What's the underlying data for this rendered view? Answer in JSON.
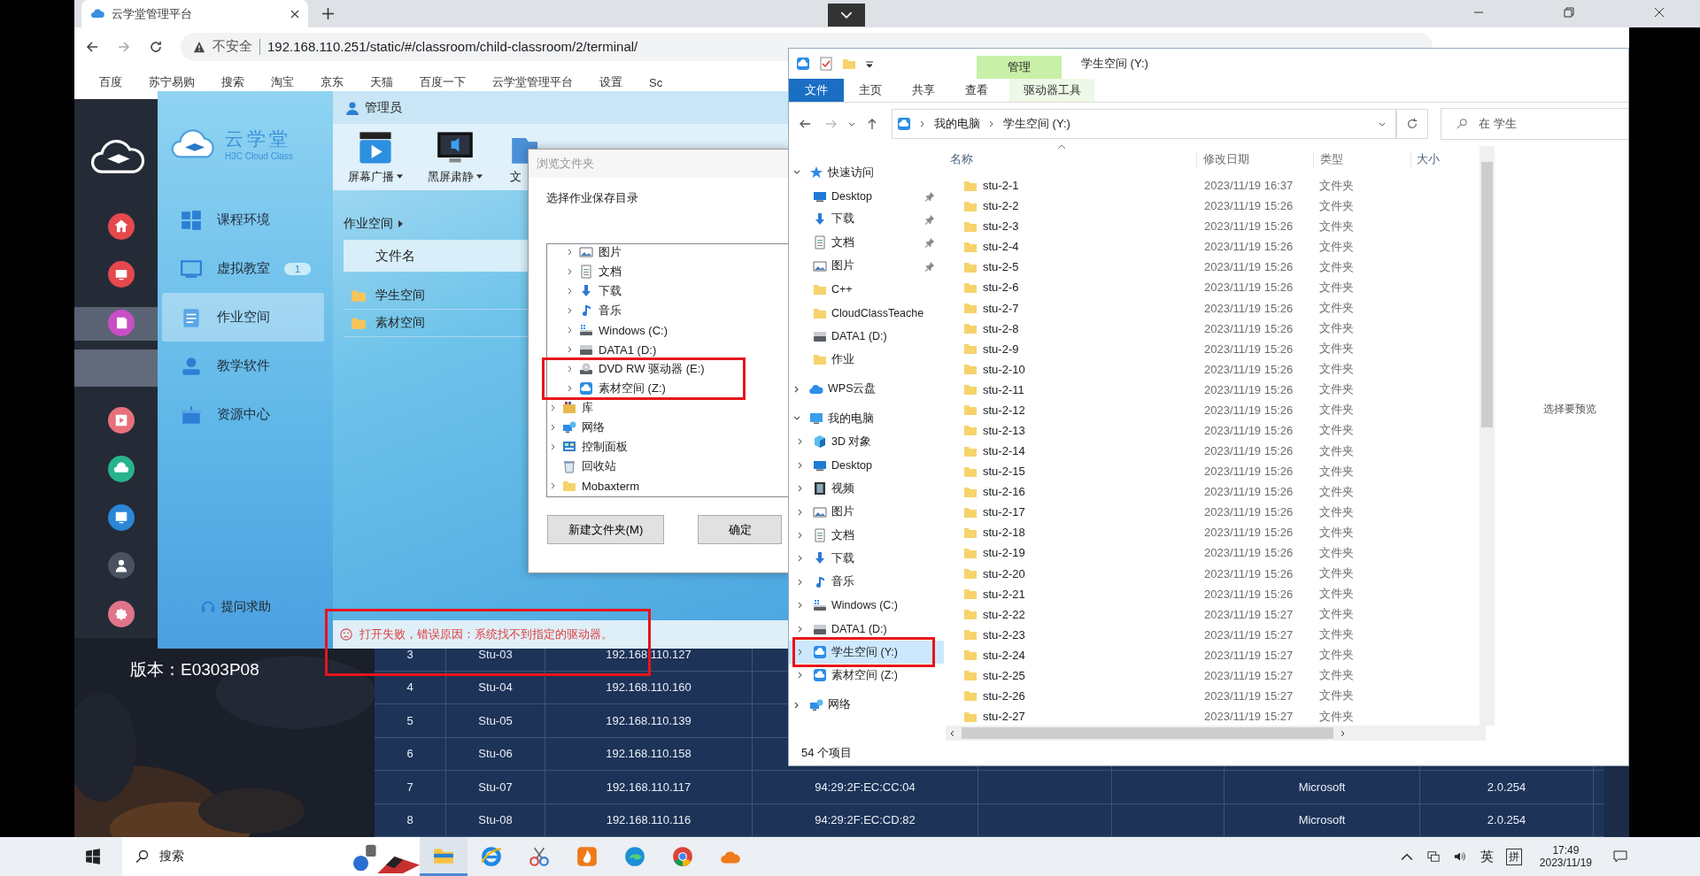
{
  "browser": {
    "tab": {
      "title": "云学堂管理平台"
    },
    "security": "不安全",
    "url": "192.168.110.251/static/#/classroom/child-classroom/2/terminal/",
    "bookmarks": [
      {
        "label": "百度"
      },
      {
        "label": "苏宁易购"
      },
      {
        "label": "搜索"
      },
      {
        "label": "淘宝"
      },
      {
        "label": "京东"
      },
      {
        "label": "天猫"
      },
      {
        "label": "百度一下"
      },
      {
        "label": "云学堂管理平台"
      },
      {
        "label": "设置"
      },
      {
        "label": "Sc"
      }
    ]
  },
  "webpage": {
    "version": "版本：E0303P08",
    "nav": [
      {
        "kind": "home",
        "color": "#e5484d",
        "selected": false
      },
      {
        "kind": "monitor",
        "color": "#e5484d",
        "selected": false
      },
      {
        "kind": "book",
        "color": "#c84fc4",
        "selected": true
      },
      {
        "kind": "sub",
        "selected": true
      },
      {
        "kind": "play",
        "color": "#e8707a",
        "selected": false
      },
      {
        "kind": "cloud",
        "color": "#27b38c",
        "selected": false
      },
      {
        "kind": "screen",
        "color": "#2b86d6",
        "selected": false
      },
      {
        "kind": "person",
        "color": "#4a5260",
        "selected": false
      },
      {
        "kind": "gear",
        "color": "#e0758a",
        "selected": false
      }
    ],
    "table": {
      "rows": [
        {
          "cells": [
            "3",
            "Stu-03",
            "192.168.110.127"
          ]
        },
        {
          "cells": [
            "4",
            "Stu-04",
            "192.168.110.160"
          ]
        },
        {
          "cells": [
            "5",
            "Stu-05",
            "192.168.110.139"
          ]
        },
        {
          "cells": [
            "6",
            "Stu-06",
            "192.168.110.158"
          ]
        },
        {
          "cells": [
            "7",
            "Stu-07",
            "192.168.110.117",
            "94:29:2F:EC:CC:04",
            "",
            "",
            "Microsoft",
            "2.0.254"
          ]
        },
        {
          "cells": [
            "8",
            "Stu-08",
            "192.168.110.116",
            "94:29:2F:EC:CD:82",
            "",
            "",
            "Microsoft",
            "2.0.254"
          ]
        }
      ]
    }
  },
  "app": {
    "logo": {
      "name": "云学堂",
      "sub": "H3C Cloud Class"
    },
    "user": "管理员",
    "tools": [
      {
        "label": "屏幕广播",
        "kind": "broadcast",
        "dropdown": true
      },
      {
        "label": "黑屏肃静",
        "kind": "blackscreen",
        "dropdown": true
      },
      {
        "label": "文",
        "kind": "files",
        "dropdown": false
      }
    ],
    "nav": [
      {
        "label": "课程环境",
        "kind": "windows",
        "selected": false
      },
      {
        "label": "虚拟教室",
        "kind": "board",
        "badge": "1",
        "selected": false
      },
      {
        "label": "作业空间",
        "kind": "notepad",
        "selected": true
      },
      {
        "label": "教学软件",
        "kind": "disk",
        "selected": false
      },
      {
        "label": "资源中心",
        "kind": "gift",
        "selected": false
      }
    ],
    "help": "提问求助",
    "breadcrumb": "作业空间",
    "list_header": "文件名",
    "files": [
      "学生空间",
      "素材空间"
    ],
    "error": "打开失败，错误原因：系统找不到指定的驱动器。"
  },
  "dialog": {
    "title": "浏览文件夹",
    "prompt": "选择作业保存目录",
    "tree": [
      {
        "children": [
          {
            "label": "图片",
            "kind": "pictures",
            "expandable": true
          },
          {
            "label": "文档",
            "kind": "doc",
            "expandable": true
          },
          {
            "label": "下载",
            "kind": "download",
            "expandable": true
          },
          {
            "label": "音乐",
            "kind": "music",
            "expandable": true
          },
          {
            "label": "Windows (C:)",
            "kind": "windrive",
            "expandable": true
          },
          {
            "label": "DATA1 (D:)",
            "kind": "drive",
            "expandable": true
          },
          {
            "label": "DVD RW 驱动器 (E:)",
            "kind": "dvd",
            "expandable": true
          },
          {
            "label": "素材空间 (Z:)",
            "kind": "netdrive",
            "expandable": true
          }
        ]
      },
      {
        "label": "库",
        "kind": "library",
        "expandable": true
      },
      {
        "label": "网络",
        "kind": "network",
        "expandable": true
      },
      {
        "label": "控制面板",
        "kind": "control",
        "expandable": true
      },
      {
        "label": "回收站",
        "kind": "recycle",
        "expandable": false
      },
      {
        "label": "Mobaxterm",
        "kind": "folder",
        "expandable": true
      }
    ],
    "buttons": [
      "新建文件夹(M)",
      "确定"
    ]
  },
  "explorer": {
    "title": "学生空间 (Y:)",
    "context_group": "管理",
    "ribbon": [
      {
        "label": "文件",
        "kind": "file"
      },
      {
        "label": "主页",
        "kind": "tab"
      },
      {
        "label": "共享",
        "kind": "tab"
      },
      {
        "label": "查看",
        "kind": "tab"
      },
      {
        "label": "驱动器工具",
        "kind": "context"
      }
    ],
    "path": [
      "我的电脑",
      "学生空间 (Y:)"
    ],
    "search_placeholder": "在 学生",
    "nav": [
      {
        "label": "快速访问",
        "kind": "star",
        "expanded": true,
        "children": [
          {
            "label": "Desktop",
            "kind": "desktop",
            "pinned": true
          },
          {
            "label": "下载",
            "kind": "download",
            "pinned": true
          },
          {
            "label": "文档",
            "kind": "doc",
            "pinned": true
          },
          {
            "label": "图片",
            "kind": "pictures",
            "pinned": true
          },
          {
            "label": "C++",
            "kind": "folder",
            "pinned": false
          },
          {
            "label": "CloudClassTeache",
            "kind": "folder",
            "pinned": false
          },
          {
            "label": "DATA1 (D:)",
            "kind": "drive",
            "pinned": false
          },
          {
            "label": "作业",
            "kind": "folder",
            "pinned": false
          }
        ]
      },
      {
        "label": "WPS云盘",
        "kind": "cloud",
        "expanded": false
      },
      {
        "label": "我的电脑",
        "kind": "pc",
        "expanded": true,
        "children": [
          {
            "label": "3D 对象",
            "kind": "cube",
            "expanded": false,
            "selected": false
          },
          {
            "label": "Desktop",
            "kind": "desktop",
            "expanded": false,
            "selected": false
          },
          {
            "label": "视频",
            "kind": "video",
            "expanded": false,
            "selected": false
          },
          {
            "label": "图片",
            "kind": "pictures",
            "expanded": false,
            "selected": false
          },
          {
            "label": "文档",
            "kind": "doc",
            "expanded": false,
            "selected": false
          },
          {
            "label": "下载",
            "kind": "download",
            "expanded": false,
            "selected": false
          },
          {
            "label": "音乐",
            "kind": "music",
            "expanded": false,
            "selected": false
          },
          {
            "label": "Windows (C:)",
            "kind": "windrive",
            "expanded": false,
            "selected": false
          },
          {
            "label": "DATA1 (D:)",
            "kind": "drive",
            "expanded": false,
            "selected": false
          },
          {
            "label": "学生空间 (Y:)",
            "kind": "netdrive",
            "expanded": false,
            "selected": true
          },
          {
            "label": "素材空间 (Z:)",
            "kind": "netdrive",
            "expanded": false,
            "selected": false
          }
        ]
      },
      {
        "label": "网络",
        "kind": "network",
        "expanded": false
      }
    ],
    "columns": [
      "名称",
      "修改日期",
      "类型",
      "大小"
    ],
    "rows": [
      {
        "name": "stu-2-1",
        "date": "2023/11/19 16:37",
        "type": "文件夹"
      },
      {
        "name": "stu-2-2",
        "date": "2023/11/19 15:26",
        "type": "文件夹"
      },
      {
        "name": "stu-2-3",
        "date": "2023/11/19 15:26",
        "type": "文件夹"
      },
      {
        "name": "stu-2-4",
        "date": "2023/11/19 15:26",
        "type": "文件夹"
      },
      {
        "name": "stu-2-5",
        "date": "2023/11/19 15:26",
        "type": "文件夹"
      },
      {
        "name": "stu-2-6",
        "date": "2023/11/19 15:26",
        "type": "文件夹"
      },
      {
        "name": "stu-2-7",
        "date": "2023/11/19 15:26",
        "type": "文件夹"
      },
      {
        "name": "stu-2-8",
        "date": "2023/11/19 15:26",
        "type": "文件夹"
      },
      {
        "name": "stu-2-9",
        "date": "2023/11/19 15:26",
        "type": "文件夹"
      },
      {
        "name": "stu-2-10",
        "date": "2023/11/19 15:26",
        "type": "文件夹"
      },
      {
        "name": "stu-2-11",
        "date": "2023/11/19 15:26",
        "type": "文件夹"
      },
      {
        "name": "stu-2-12",
        "date": "2023/11/19 15:26",
        "type": "文件夹"
      },
      {
        "name": "stu-2-13",
        "date": "2023/11/19 15:26",
        "type": "文件夹"
      },
      {
        "name": "stu-2-14",
        "date": "2023/11/19 15:26",
        "type": "文件夹"
      },
      {
        "name": "stu-2-15",
        "date": "2023/11/19 15:26",
        "type": "文件夹"
      },
      {
        "name": "stu-2-16",
        "date": "2023/11/19 15:26",
        "type": "文件夹"
      },
      {
        "name": "stu-2-17",
        "date": "2023/11/19 15:26",
        "type": "文件夹"
      },
      {
        "name": "stu-2-18",
        "date": "2023/11/19 15:26",
        "type": "文件夹"
      },
      {
        "name": "stu-2-19",
        "date": "2023/11/19 15:26",
        "type": "文件夹"
      },
      {
        "name": "stu-2-20",
        "date": "2023/11/19 15:26",
        "type": "文件夹"
      },
      {
        "name": "stu-2-21",
        "date": "2023/11/19 15:26",
        "type": "文件夹"
      },
      {
        "name": "stu-2-22",
        "date": "2023/11/19 15:27",
        "type": "文件夹"
      },
      {
        "name": "stu-2-23",
        "date": "2023/11/19 15:27",
        "type": "文件夹"
      },
      {
        "name": "stu-2-24",
        "date": "2023/11/19 15:27",
        "type": "文件夹"
      },
      {
        "name": "stu-2-25",
        "date": "2023/11/19 15:27",
        "type": "文件夹"
      },
      {
        "name": "stu-2-26",
        "date": "2023/11/19 15:27",
        "type": "文件夹"
      },
      {
        "name": "stu-2-27",
        "date": "2023/11/19 15:27",
        "type": "文件夹"
      }
    ],
    "status": "54 个项目",
    "preview": "选择要预览"
  },
  "taskbar": {
    "search": "搜索",
    "apps": [
      {
        "kind": "explorer",
        "active": true
      },
      {
        "kind": "ie",
        "active": false
      },
      {
        "kind": "snip",
        "active": false
      },
      {
        "kind": "flame",
        "active": false
      },
      {
        "kind": "edge",
        "active": false
      },
      {
        "kind": "chrome",
        "active": false
      },
      {
        "kind": "cloud",
        "active": false
      }
    ],
    "ime": "英",
    "ime_mode": "拼",
    "time": "17:49",
    "date": "2023/11/19"
  },
  "annotations": [
    {
      "kind": "dialog-drives"
    },
    {
      "kind": "error-bar"
    },
    {
      "kind": "nav-drive"
    }
  ]
}
